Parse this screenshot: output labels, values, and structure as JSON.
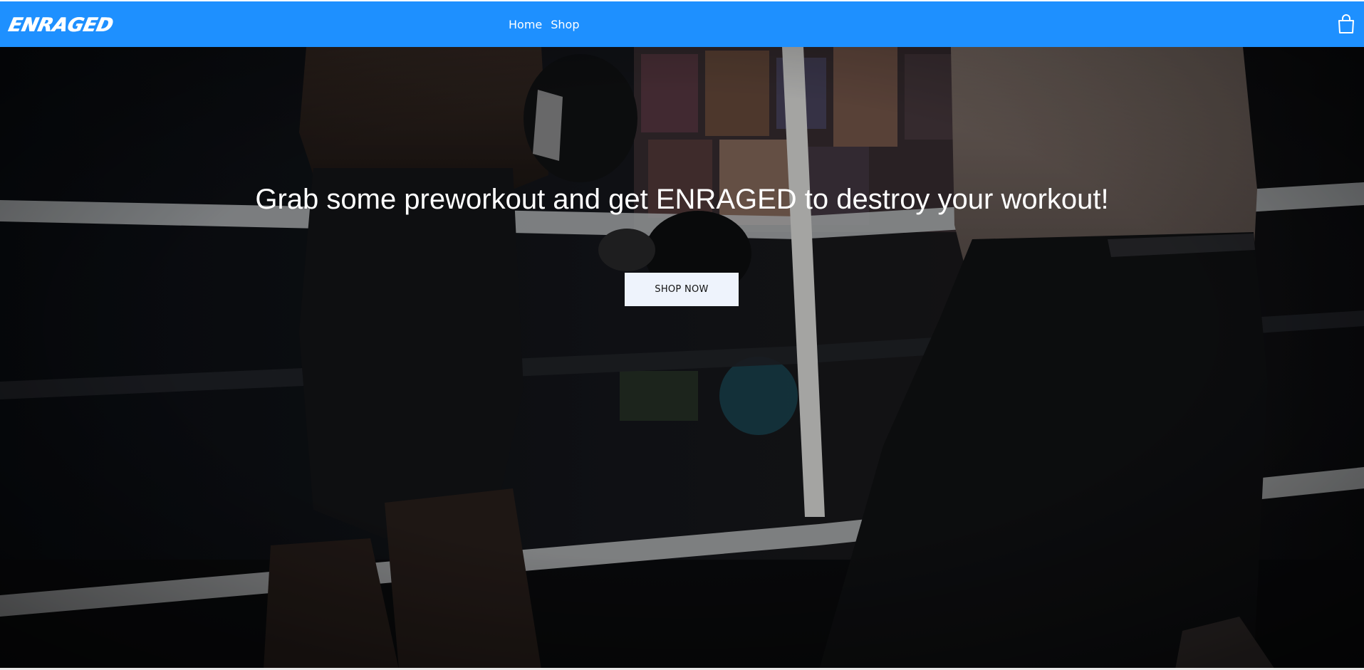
{
  "header": {
    "brand": "ENRAGED",
    "nav": [
      {
        "label": "Home"
      },
      {
        "label": "Shop"
      }
    ],
    "cart_icon": "shopping-bag-icon",
    "background_color": "#1e90ff"
  },
  "hero": {
    "headline": "Grab some preworkout and get ENRAGED to destroy your workout!",
    "cta_label": "SHOP NOW",
    "background_image": "boxing-ring-training-photo"
  }
}
